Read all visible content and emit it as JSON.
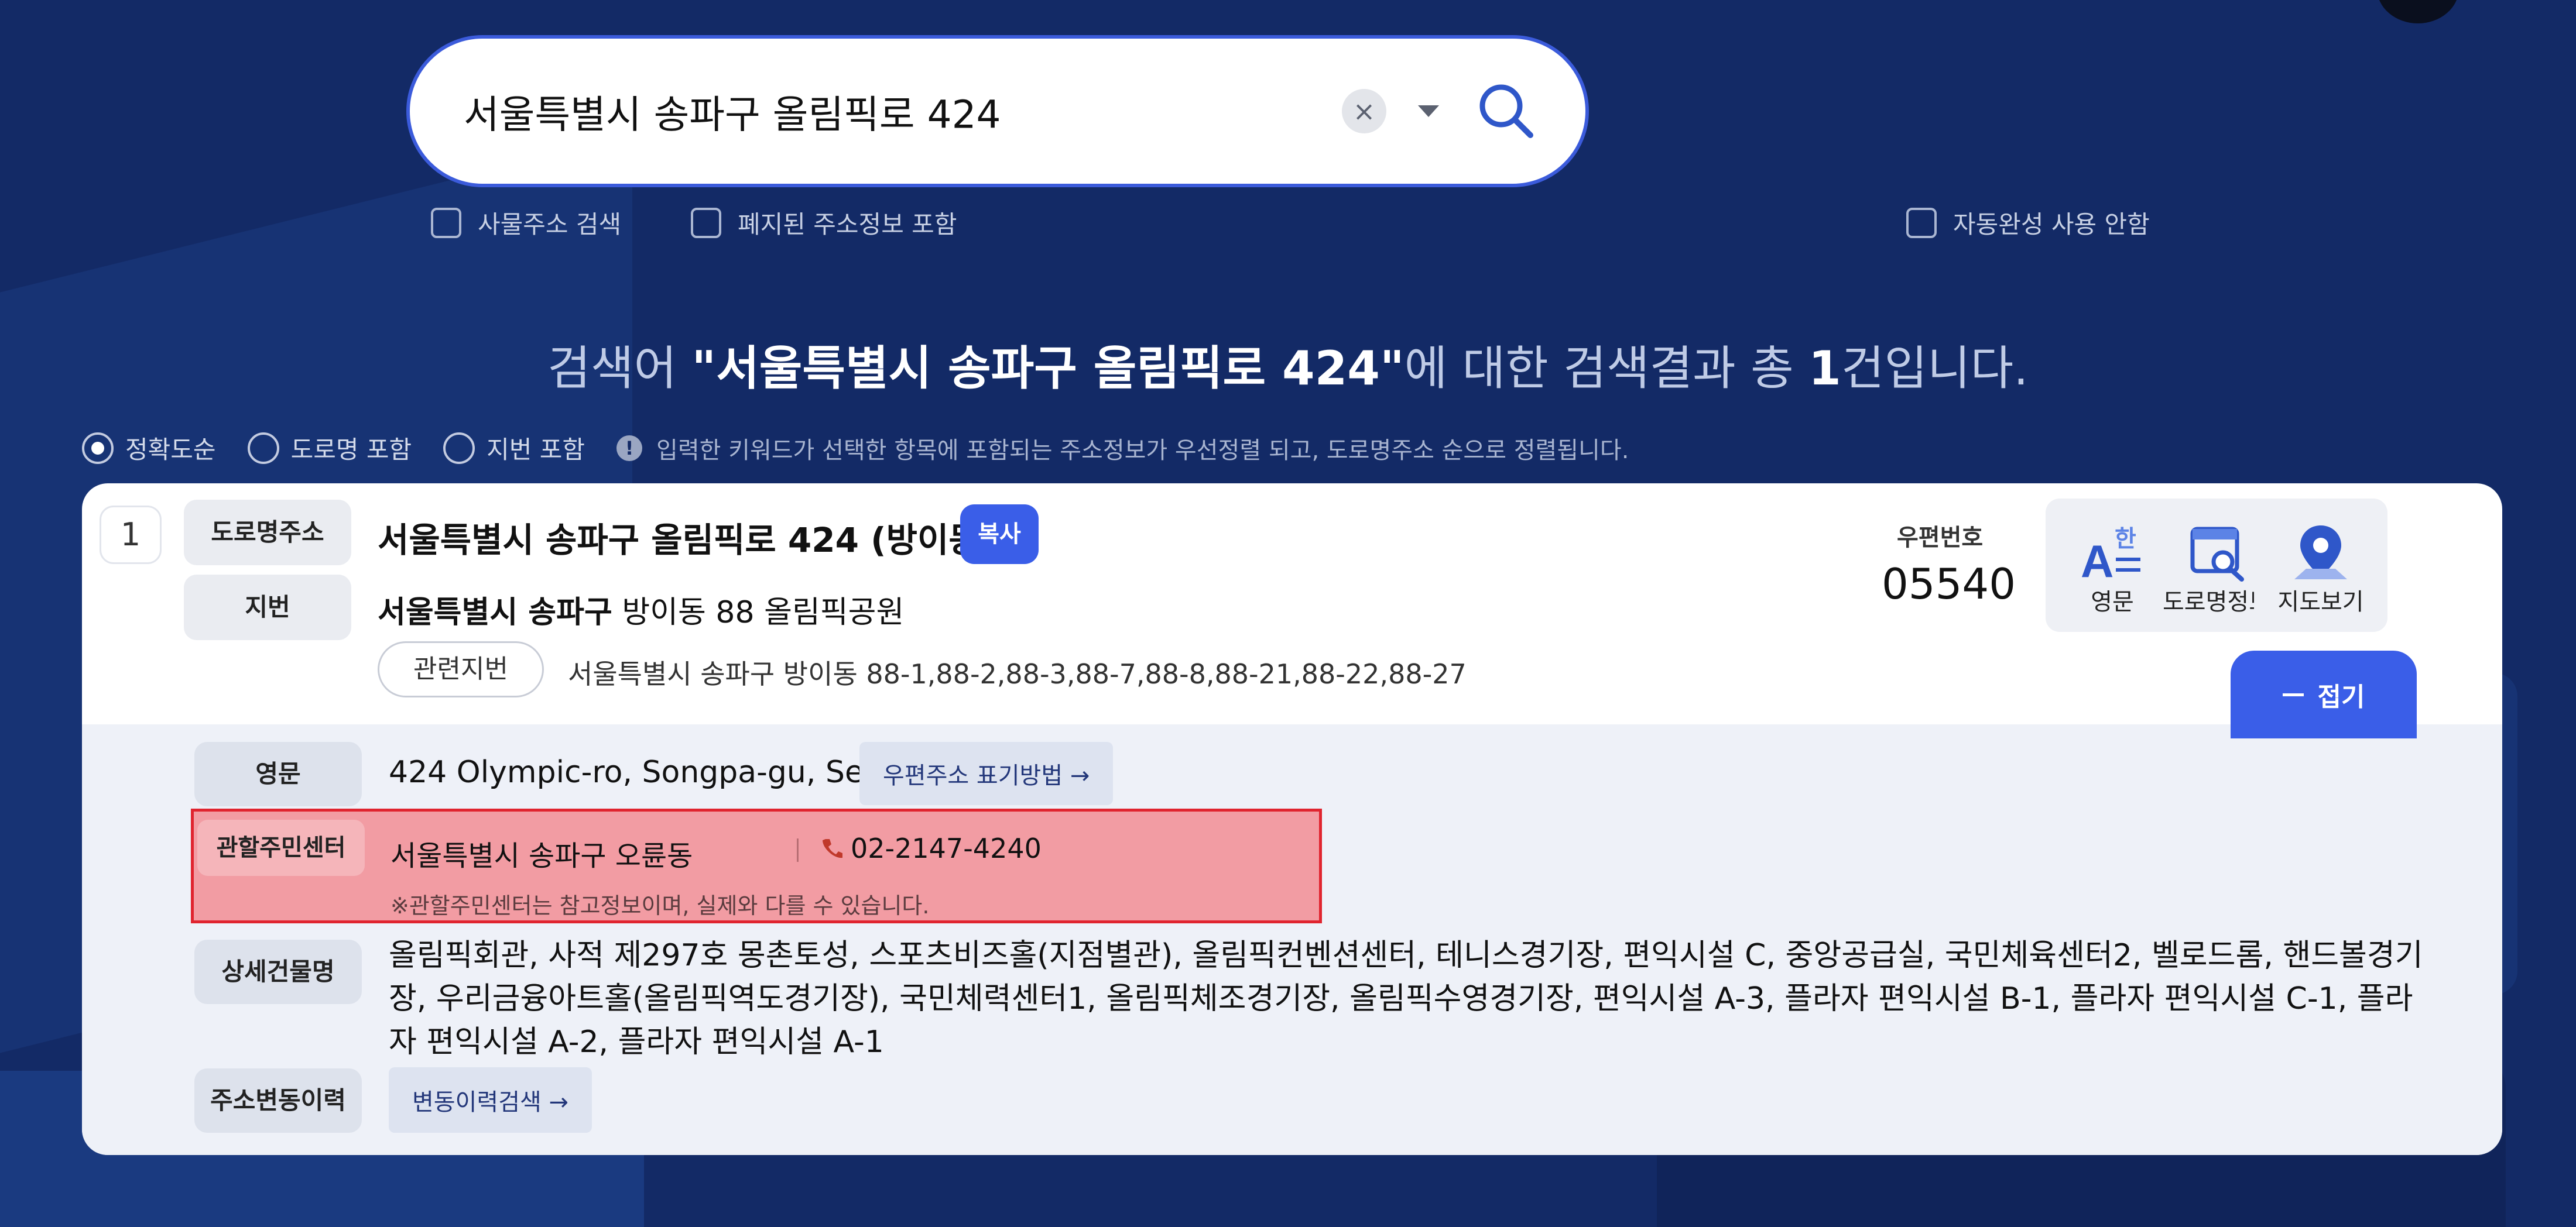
{
  "search": {
    "query": "서울특별시 송파구 올림픽로 424",
    "clear_label": "×"
  },
  "options": {
    "building_search": "사물주소 검색",
    "include_abolished": "폐지된 주소정보 포함",
    "disable_autocomplete": "자동완성 사용 안함"
  },
  "result_title": {
    "prefix": "검색어 ",
    "keyword": "\"서울특별시 송파구 올림픽로 424\"",
    "middle": "에 대한 검색결과 총 ",
    "count": "1",
    "suffix": "건입니다."
  },
  "sort": {
    "items": [
      "정확도순",
      "도로명 포함",
      "지번 포함"
    ],
    "selected": "정확도순",
    "hint": "입력한 키워드가 선택한 항목에 포함되는 주소정보가 우선정렬 되고, 도로명주소 순으로 정렬됩니다."
  },
  "result": {
    "index": "1",
    "road_tag": "도로명주소",
    "road_address": "서울특별시 송파구 올림픽로 424 (방이동)",
    "copy_label": "복사",
    "jibun_tag": "지번",
    "jibun_bold": "서울특별시 송파구",
    "jibun_rest": " 방이동 88 올림픽공원",
    "related_label": "관련지번",
    "related_text": "서울특별시 송파구 방이동 88-1,88-2,88-3,88-7,88-8,88-21,88-22,88-27",
    "zip_label": "우편번호",
    "zip_code": "05540",
    "actions": {
      "english": "영문",
      "road_info": "도로명정보",
      "map": "지도보기"
    },
    "fold_label": "접기"
  },
  "detail": {
    "english_tag": "영문",
    "english_addr": "424 Olympic-ro, Songpa-gu, Seoul",
    "postal_link": "우편주소 표기방법 →",
    "center_tag": "관할주민센터",
    "center_name": "서울특별시 송파구 오륜동",
    "center_phone": "02-2147-4240",
    "center_note": "※관할주민센터는 참고정보이며, 실제와 다를 수 있습니다.",
    "building_tag": "상세건물명",
    "building_names": "올림픽회관, 사적 제297호 몽촌토성, 스포츠비즈홀(지점별관), 올림픽컨벤션센터, 테니스경기장, 편익시설 C, 중앙공급실, 국민체육센터2, 벨로드롬, 핸드볼경기장, 우리금융아트홀(올림픽역도경기장), 국민체력센터1, 올림픽체조경기장, 올림픽수영경기장, 편익시설 A-3, 플라자 편익시설 B-1, 플라자 편익시설 C-1, 플라자 편익시설 A-2, 플라자 편익시설 A-1",
    "history_tag": "주소변동이력",
    "history_link": "변동이력검색 →"
  },
  "colors": {
    "background": "#132a66",
    "accent": "#3a5ee8",
    "highlight_fill": "#f29ca3",
    "highlight_border": "#e0242f"
  }
}
